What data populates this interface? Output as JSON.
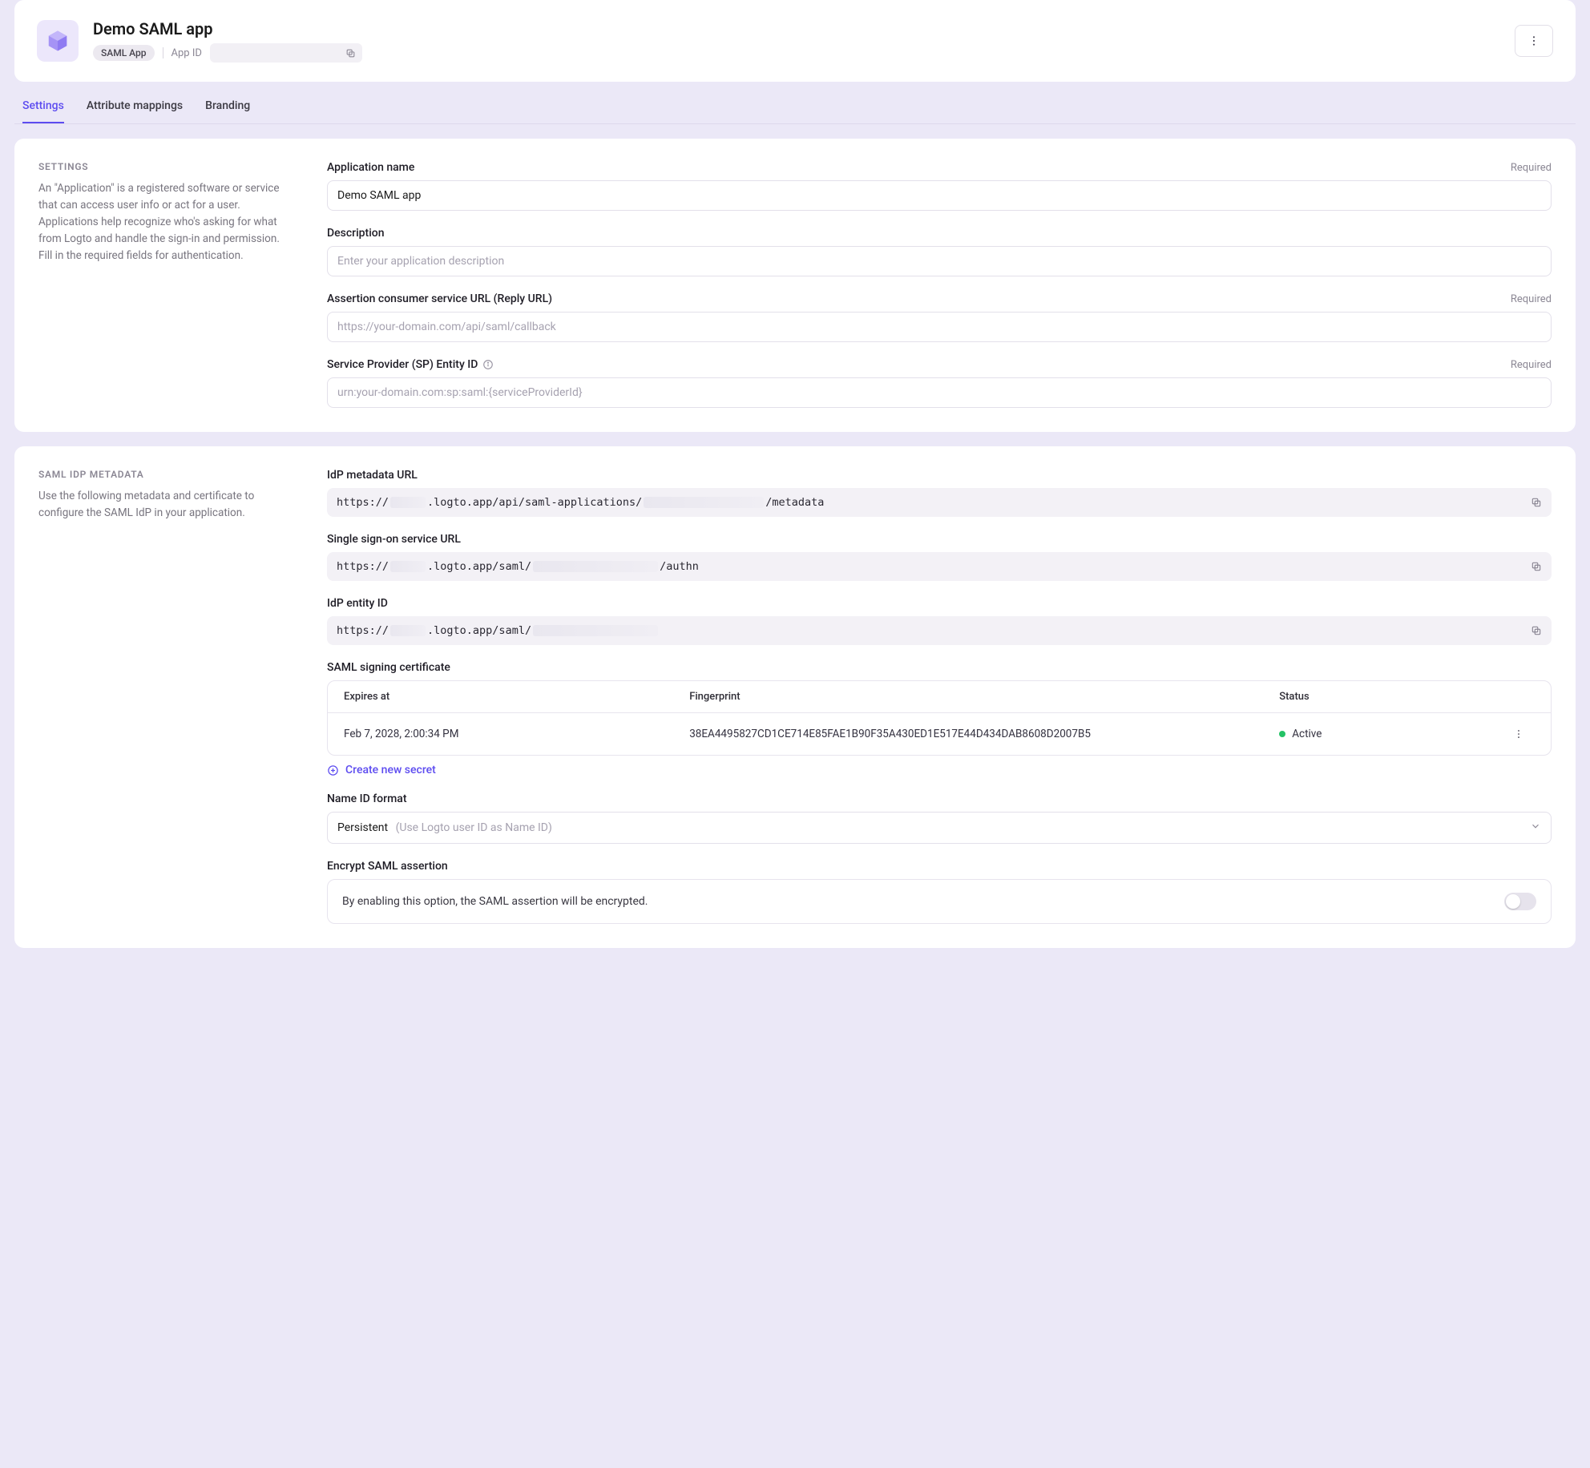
{
  "header": {
    "title": "Demo SAML app",
    "badge": "SAML App",
    "appIdLabel": "App ID"
  },
  "tabs": [
    {
      "label": "Settings",
      "active": true
    },
    {
      "label": "Attribute mappings",
      "active": false
    },
    {
      "label": "Branding",
      "active": false
    }
  ],
  "settingsSection": {
    "heading": "SETTINGS",
    "description": "An \"Application\" is a registered software or service that can access user info or act for a user. Applications help recognize who's asking for what from Logto and handle the sign-in and permission. Fill in the required fields for authentication.",
    "requiredLabel": "Required",
    "fields": {
      "appName": {
        "label": "Application name",
        "value": "Demo SAML app"
      },
      "description": {
        "label": "Description",
        "placeholder": "Enter your application description"
      },
      "acsUrl": {
        "label": "Assertion consumer service URL (Reply URL)",
        "placeholder": "https://your-domain.com/api/saml/callback"
      },
      "spEntityId": {
        "label": "Service Provider (SP) Entity ID",
        "placeholder": "urn:your-domain.com:sp:saml:{serviceProviderId}"
      }
    }
  },
  "idpSection": {
    "heading": "SAML IDP METADATA",
    "description": "Use the following metadata and certificate to configure the SAML IdP in your application.",
    "fields": {
      "metadataUrl": {
        "label": "IdP metadata URL",
        "parts": [
          "https://",
          ".logto.app/api/saml-applications/",
          "/metadata"
        ]
      },
      "ssoUrl": {
        "label": "Single sign-on service URL",
        "parts": [
          "https://",
          ".logto.app/saml/",
          "/authn"
        ]
      },
      "entityId": {
        "label": "IdP entity ID",
        "parts": [
          "https://",
          ".logto.app/saml/",
          ""
        ]
      },
      "cert": {
        "label": "SAML signing certificate",
        "columns": {
          "expires": "Expires at",
          "fingerprint": "Fingerprint",
          "status": "Status"
        },
        "row": {
          "expiresAt": "Feb 7, 2028, 2:00:34 PM",
          "fingerprint": "38EA4495827CD1CE714E85FAE1B90F35A430ED1E517E44D434DAB8608D2007B5",
          "status": "Active"
        },
        "createLabel": "Create new secret"
      },
      "nameId": {
        "label": "Name ID format",
        "value": "Persistent",
        "hint": "(Use Logto user ID as Name ID)"
      },
      "encrypt": {
        "label": "Encrypt SAML assertion",
        "text": "By enabling this option, the SAML assertion will be encrypted."
      }
    }
  }
}
